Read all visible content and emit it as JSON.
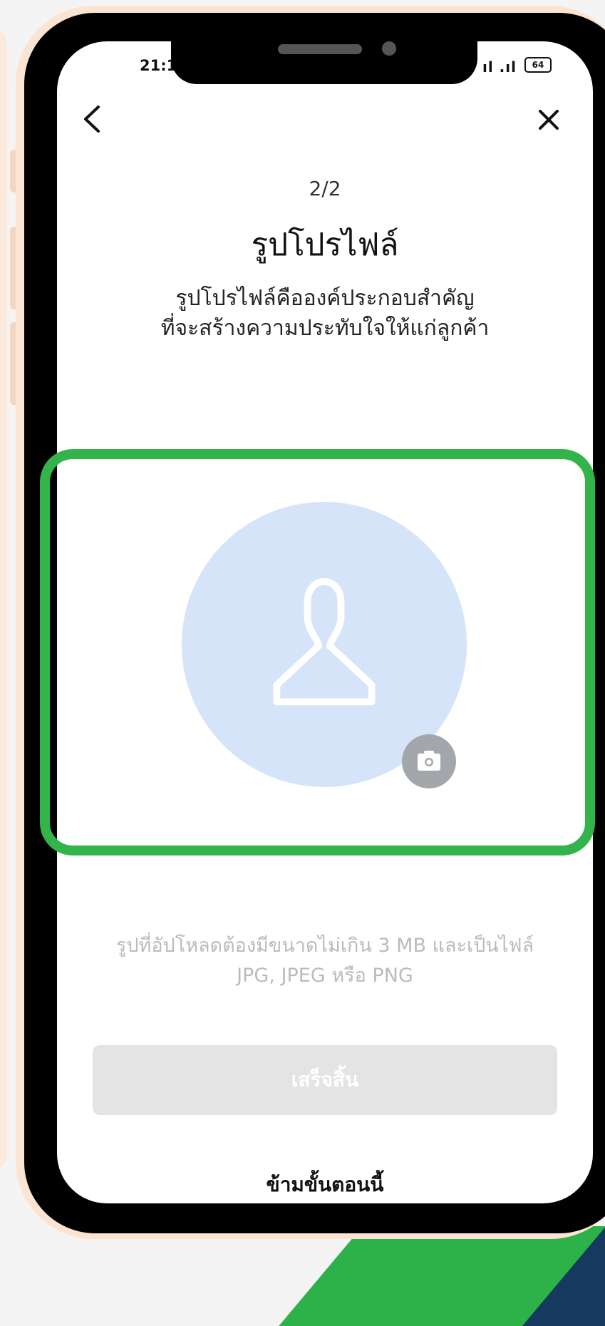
{
  "status_bar": {
    "time": "21:1",
    "signal": "ıl .ıl",
    "battery": "64"
  },
  "header": {
    "step": "2/2",
    "title": "รูปโปรไฟล์",
    "subtitle_line1": "รูปโปรไฟล์คือองค์ประกอบสำคัญ",
    "subtitle_line2": "ที่จะสร้างความประทับใจให้แก่ลูกค้า"
  },
  "upload": {
    "note_line1": "รูปที่อัปโหลดต้องมีขนาดไม่เกิน 3 MB และเป็นไฟล์",
    "note_line2": "JPG, JPEG หรือ PNG"
  },
  "actions": {
    "done_label": "เสร็จสิ้น",
    "skip_label": "ข้ามขั้นตอนนี้"
  },
  "colors": {
    "highlight": "#33b44a",
    "avatar_bg": "#d5e4f8",
    "disabled_button": "#e4e4e4"
  },
  "icons": {
    "back": "chevron-left-icon",
    "close": "close-icon",
    "avatar": "person-icon",
    "camera": "camera-icon"
  }
}
